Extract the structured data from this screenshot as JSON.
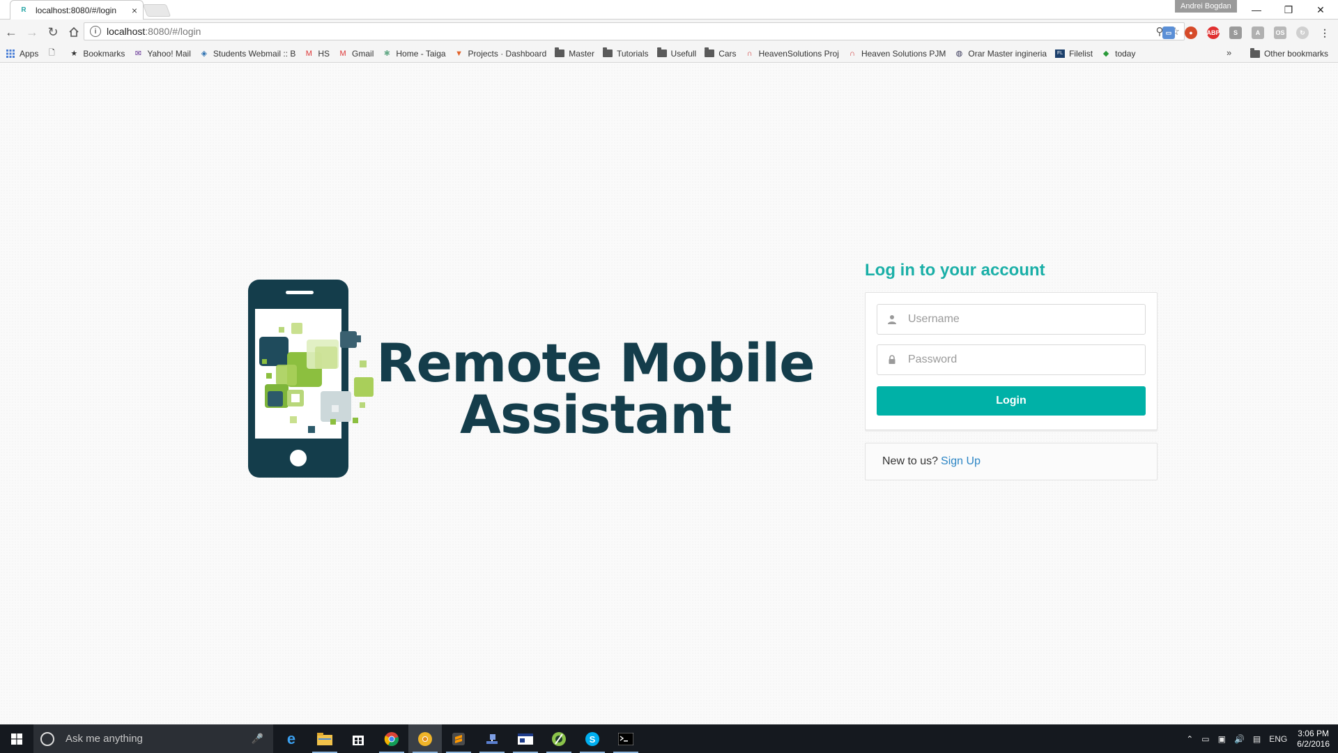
{
  "browser": {
    "tab_title": "localhost:8080/#/login",
    "tab_favicon": "R",
    "tab_close": "×",
    "profile_name": "Andrei Bogdan",
    "url_host": "localhost",
    "url_path": ":8080/#/login",
    "window_controls": {
      "minimize": "—",
      "restore": "❐",
      "close": "✕"
    }
  },
  "bookmarks": {
    "apps_label": "Apps",
    "items": [
      {
        "label": "",
        "icon": "page-icon"
      },
      {
        "label": "Bookmarks",
        "icon": "star-icon"
      },
      {
        "label": "Yahoo! Mail",
        "icon": "yahoo-icon"
      },
      {
        "label": "Students Webmail :: B",
        "icon": "webmail-icon"
      },
      {
        "label": "HS",
        "icon": "gmail-icon"
      },
      {
        "label": "Gmail",
        "icon": "gmail-icon"
      },
      {
        "label": "Home - Taiga",
        "icon": "taiga-icon"
      },
      {
        "label": "Projects · Dashboard",
        "icon": "gitlab-icon"
      },
      {
        "label": "Master",
        "icon": "folder-icon"
      },
      {
        "label": "Tutorials",
        "icon": "folder-icon"
      },
      {
        "label": "Usefull",
        "icon": "folder-icon"
      },
      {
        "label": "Cars",
        "icon": "folder-icon"
      },
      {
        "label": "HeavenSolutions Proj",
        "icon": "heaven-icon"
      },
      {
        "label": "Heaven Solutions PJM",
        "icon": "heaven-icon"
      },
      {
        "label": "Orar Master ingineria",
        "icon": "globe-icon"
      },
      {
        "label": "Filelist",
        "icon": "filelist-icon"
      },
      {
        "label": "today",
        "icon": "today-icon"
      }
    ],
    "overflow": "»",
    "other_label": "Other bookmarks"
  },
  "brand": {
    "line1": "Remote Mobile",
    "line2": "Assistant"
  },
  "login": {
    "title": "Log in to your account",
    "username_placeholder": "Username",
    "password_placeholder": "Password",
    "button_label": "Login",
    "signup_prompt": "New to us?",
    "signup_link": "Sign Up"
  },
  "taskbar": {
    "search_placeholder": "Ask me anything",
    "language": "ENG",
    "time": "3:06 PM",
    "date": "6/2/2016"
  },
  "colors": {
    "accent": "#00b1a7",
    "brand_dark": "#143d4b",
    "link": "#2a84c4",
    "phone_green": "#8cbf3f"
  }
}
